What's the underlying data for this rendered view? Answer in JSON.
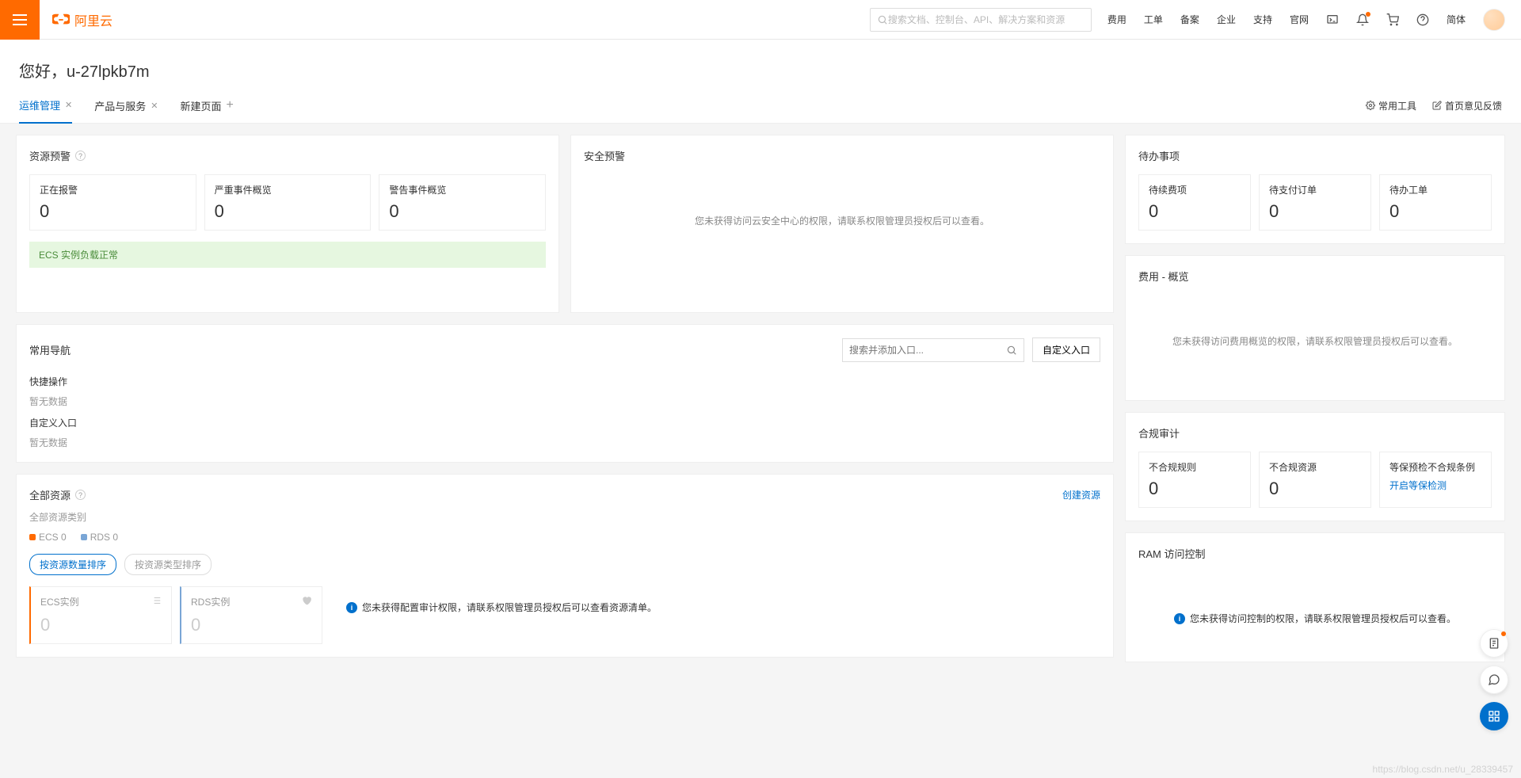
{
  "header": {
    "brand": "阿里云",
    "search_placeholder": "搜索文档、控制台、API、解决方案和资源",
    "links": [
      "费用",
      "工单",
      "备案",
      "企业",
      "支持",
      "官网"
    ],
    "lang": "简体"
  },
  "greeting": "您好，u-27lpkb7m",
  "tabs": {
    "items": [
      {
        "label": "运维管理",
        "active": true,
        "closable": true
      },
      {
        "label": "产品与服务",
        "active": false,
        "closable": true
      },
      {
        "label": "新建页面",
        "active": false,
        "closable": false,
        "add": true
      }
    ],
    "right": {
      "tools": "常用工具",
      "feedback": "首页意见反馈"
    }
  },
  "resource_alert": {
    "title": "资源预警",
    "stats": [
      {
        "label": "正在报警",
        "value": "0"
      },
      {
        "label": "严重事件概览",
        "value": "0"
      },
      {
        "label": "警告事件概览",
        "value": "0"
      }
    ],
    "banner": "ECS 实例负载正常"
  },
  "security_alert": {
    "title": "安全预警",
    "message": "您未获得访问云安全中心的权限，请联系权限管理员授权后可以查看。"
  },
  "todo": {
    "title": "待办事项",
    "stats": [
      {
        "label": "待续费项",
        "value": "0"
      },
      {
        "label": "待支付订单",
        "value": "0"
      },
      {
        "label": "待办工单",
        "value": "0"
      }
    ]
  },
  "cost": {
    "title": "费用 - 概览",
    "message": "您未获得访问费用概览的权限，请联系权限管理员授权后可以查看。"
  },
  "nav": {
    "title": "常用导航",
    "search_placeholder": "搜索并添加入口...",
    "custom_btn": "自定义入口",
    "quick_label": "快捷操作",
    "quick_empty": "暂无数据",
    "custom_label": "自定义入口",
    "custom_empty": "暂无数据"
  },
  "compliance": {
    "title": "合规审计",
    "stats": [
      {
        "label": "不合规规则",
        "value": "0"
      },
      {
        "label": "不合规资源",
        "value": "0"
      },
      {
        "label": "等保预检不合规条例",
        "link": "开启等保检测"
      }
    ]
  },
  "resources": {
    "title": "全部资源",
    "create": "创建资源",
    "category": "全部资源类别",
    "legend": [
      {
        "name": "ECS 0",
        "color": "#ff6a00"
      },
      {
        "name": "RDS 0",
        "color": "#7aa6d6"
      }
    ],
    "sort": [
      {
        "label": "按资源数量排序",
        "active": true
      },
      {
        "label": "按资源类型排序",
        "active": false
      }
    ],
    "instances": [
      {
        "label": "ECS实例",
        "value": "0",
        "type": "ecs"
      },
      {
        "label": "RDS实例",
        "value": "0",
        "type": "rds"
      }
    ],
    "message": "您未获得配置审计权限，请联系权限管理员授权后可以查看资源清单。"
  },
  "ram": {
    "title": "RAM 访问控制",
    "message": "您未获得访问控制的权限，请联系权限管理员授权后可以查看。"
  },
  "watermark": "https://blog.csdn.net/u_28339457"
}
